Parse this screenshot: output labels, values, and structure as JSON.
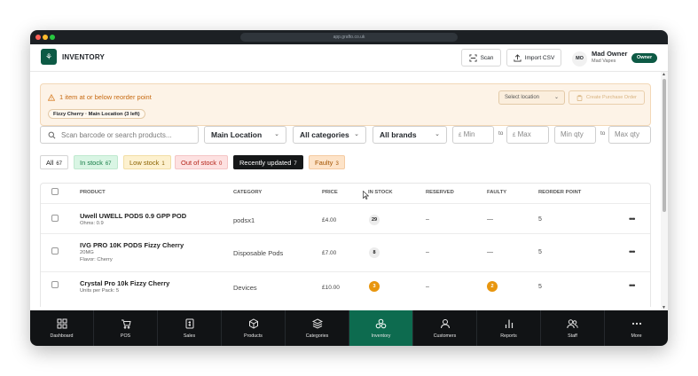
{
  "browser": {
    "url": "app.grafto.co.uk"
  },
  "app": {
    "title": "INVENTORY",
    "logo_glyph": "⚘"
  },
  "toolbar": {
    "scan_label": "Scan",
    "import_label": "Import CSV"
  },
  "user": {
    "initials": "MO",
    "name": "Mad Owner",
    "shop": "Mad Vapes",
    "role": "Owner"
  },
  "alert": {
    "title": "1 item at or below reorder point",
    "chip": "Fizzy Cherry · Main Location (3 left)",
    "select_placeholder": "Select location",
    "create_po_label": "Create Purchase Order"
  },
  "filters": {
    "search_placeholder": "Scan barcode or search products...",
    "location": "Main Location",
    "categories": "All categories",
    "brands": "All brands",
    "min_placeholder": "Min",
    "max_placeholder": "Max",
    "currency": "£",
    "to_label": "to",
    "min_qty_placeholder": "Min qty",
    "max_qty_placeholder": "Max qty"
  },
  "tabs": [
    {
      "label": "All",
      "count": "67"
    },
    {
      "label": "In stock",
      "count": "67"
    },
    {
      "label": "Low stock",
      "count": "1"
    },
    {
      "label": "Out of stock",
      "count": "0"
    },
    {
      "label": "Recently updated",
      "count": "7"
    },
    {
      "label": "Faulty",
      "count": "3"
    }
  ],
  "table": {
    "headers": {
      "product": "PRODUCT",
      "category": "CATEGORY",
      "price": "PRICE",
      "in_stock": "IN STOCK",
      "reserved": "RESERVED",
      "faulty": "FAULTY",
      "reorder_point": "REORDER POINT"
    },
    "rows": [
      {
        "name": "Uwell UWELL PODS 0.9 GPP POD",
        "sub1": "Ohms: 0.9",
        "sub2": "",
        "category": "podsx1",
        "price": "£4.00",
        "in_stock": "29",
        "reserved": "–",
        "faulty": "—",
        "reorder": "5",
        "more": "•••"
      },
      {
        "name": "IVG PRO 10K PODS Fizzy Cherry",
        "sub1": "20MG",
        "sub2": "Flavor: Cherry",
        "category": "Disposable Pods",
        "price": "£7.00",
        "in_stock": "8",
        "reserved": "–",
        "faulty": "—",
        "reorder": "5",
        "more": "•••"
      },
      {
        "name": "Crystal Pro 10k Fizzy Cherry",
        "sub1": "Units per Pack: 5",
        "sub2": "",
        "category": "Devices",
        "price": "£10.00",
        "in_stock": "3",
        "reserved": "–",
        "faulty": "2",
        "reorder": "5",
        "more": "•••"
      }
    ]
  },
  "nav": [
    {
      "label": "Dashboard",
      "icon": "grid-icon"
    },
    {
      "label": "POS",
      "icon": "cart-icon"
    },
    {
      "label": "Sales",
      "icon": "receipt-icon"
    },
    {
      "label": "Products",
      "icon": "box-icon"
    },
    {
      "label": "Categories",
      "icon": "layers-icon"
    },
    {
      "label": "Inventory",
      "icon": "inventory-icon"
    },
    {
      "label": "Customers",
      "icon": "person-icon"
    },
    {
      "label": "Reports",
      "icon": "bar-chart-icon"
    },
    {
      "label": "Staff",
      "icon": "people-icon"
    },
    {
      "label": "More",
      "icon": "ellipsis-icon"
    }
  ],
  "colors": {
    "brand": "#0d5a45",
    "nav_active": "#0d6b4f",
    "alert_text": "#c76a12",
    "in_stock_bg": "#d9f5e4",
    "low_stock_bg": "#fdf1cf",
    "out_stock_bg": "#fde1e1",
    "faulty_bg": "#fde3c8",
    "low_badge": "#e8960f"
  }
}
